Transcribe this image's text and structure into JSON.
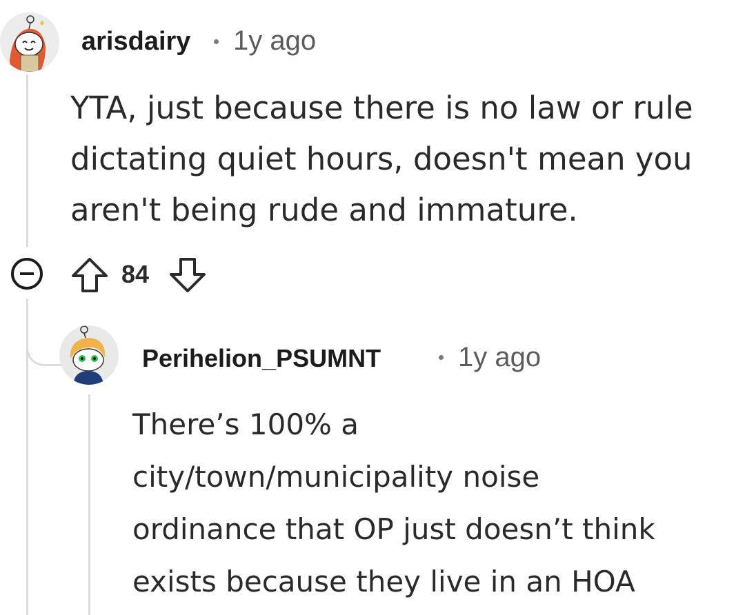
{
  "comments": [
    {
      "author": "arisdairy",
      "age": "1y ago",
      "body_lines": [
        "YTA, just because there is no law or rule",
        "dictating quiet hours, doesn't mean you",
        "aren't being rude and immature."
      ],
      "avatar_icon": "snoo-avatar-redhead-icon"
    },
    {
      "author": "Perihelion_PSUMNT",
      "age": "1y ago",
      "body_lines": [
        "There’s 100% a",
        "city/town/municipality noise",
        "ordinance that OP just doesn’t think",
        "exists because they live in an HOA"
      ],
      "avatar_icon": "snoo-avatar-blonde-icon"
    }
  ],
  "actions": {
    "vote_count": "84",
    "collapse_icon": "collapse-minus-icon",
    "upvote_icon": "upvote-arrow-icon",
    "downvote_icon": "downvote-arrow-icon"
  },
  "colors": {
    "text": "#1c1c1c",
    "meta": "#5c5c5c",
    "thread_line": "#dcdcdc"
  }
}
